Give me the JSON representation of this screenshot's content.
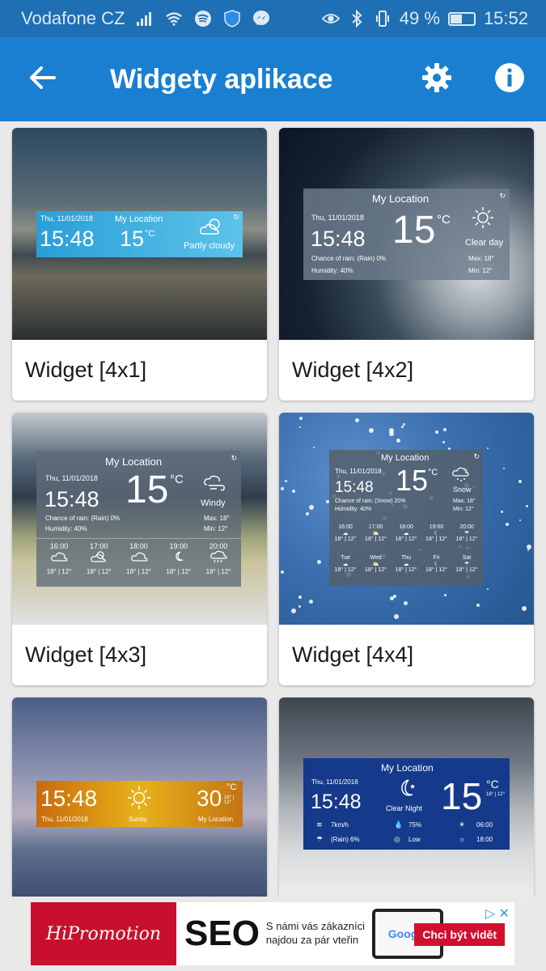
{
  "status_bar": {
    "carrier": "Vodafone CZ",
    "battery": "49 %",
    "battery_level": 0.49,
    "time": "15:52",
    "icons": [
      "signal-icon",
      "wifi-icon",
      "spotify-icon",
      "shield-icon",
      "messenger-icon",
      "eye-icon",
      "bluetooth-icon",
      "vibrate-icon",
      "battery-icon"
    ]
  },
  "app_bar": {
    "title": "Widgety aplikace",
    "back_icon": "arrow-back-icon",
    "settings_icon": "gear-icon",
    "info_icon": "info-icon",
    "color": "#1a7fd0"
  },
  "widgets": [
    {
      "label": "Widget [4x1]",
      "date": "Thu, 11/01/2018",
      "location": "My Location",
      "time": "15:48",
      "temp": "15",
      "unit": "°C",
      "condition": "Partly cloudy"
    },
    {
      "label": "Widget [4x2]",
      "date": "Thu, 11/01/2018",
      "location": "My Location",
      "time": "15:48",
      "temp": "15",
      "unit": "°C",
      "condition": "Clear day",
      "rain": "Chance of rain: (Rain) 0%",
      "humidity": "Humidity: 40%",
      "max": "Max: 18°",
      "min": "Min: 12°"
    },
    {
      "label": "Widget [4x3]",
      "date": "Thu, 11/01/2018",
      "location": "My Location",
      "time": "15:48",
      "temp": "15",
      "unit": "°C",
      "condition": "Windy",
      "rain": "Chance of rain: (Rain) 0%",
      "humidity": "Humidity: 40%",
      "max": "Max: 18°",
      "min": "Min: 12°",
      "hours": [
        {
          "t": "16:00",
          "r": "18° | 12°"
        },
        {
          "t": "17:00",
          "r": "18° | 12°"
        },
        {
          "t": "18:00",
          "r": "18° | 12°"
        },
        {
          "t": "19:00",
          "r": "18° | 12°"
        },
        {
          "t": "20:00",
          "r": "18° | 12°"
        }
      ]
    },
    {
      "label": "Widget [4x4]",
      "date": "Thu, 11/01/2018",
      "location": "My Location",
      "time": "15:48",
      "temp": "15",
      "unit": "°C",
      "condition": "Snow",
      "rain": "Chance of rain: (Snow) 20%",
      "humidity": "Humidity: 40%",
      "max": "Max: 18°",
      "min": "Min: 12°",
      "hours": [
        {
          "t": "16:00",
          "r": "18° | 12°"
        },
        {
          "t": "17:00",
          "r": "18° | 12°"
        },
        {
          "t": "18:00",
          "r": "18° | 12°"
        },
        {
          "t": "19:00",
          "r": "18° | 12°"
        },
        {
          "t": "20:00",
          "r": "18° | 12°"
        }
      ],
      "days": [
        {
          "t": "Tue",
          "r": "18° | 12°"
        },
        {
          "t": "Wed",
          "r": "18° | 12°"
        },
        {
          "t": "Thu",
          "r": "18° | 12°"
        },
        {
          "t": "Fri",
          "r": "18° | 12°"
        },
        {
          "t": "Sat",
          "r": "18° | 12°"
        }
      ]
    },
    {
      "label": "",
      "date": "Thu, 11/01/2018",
      "location": "My Location",
      "time": "15:48",
      "temp": "30",
      "unit": "°C",
      "condition": "Sunny",
      "range": "18° | 12°"
    },
    {
      "label": "",
      "date": "Thu, 11/01/2018",
      "location": "My Location",
      "time": "15:48",
      "temp": "15",
      "unit": "°C",
      "condition": "Clear Night",
      "range": "18° | 12°",
      "wind": "7km/h",
      "humidity": "75%",
      "rain": "(Rain) 6%",
      "pressure": "Low",
      "sunrise": "06:00",
      "sunset": "18:00"
    }
  ],
  "ad": {
    "brand": "HiPromotion",
    "headline": "SEO",
    "tagline": "S námi vás zákazníci najdou za pár vteřin",
    "tablet_text": "Google",
    "cta": "Chci být vidět"
  }
}
